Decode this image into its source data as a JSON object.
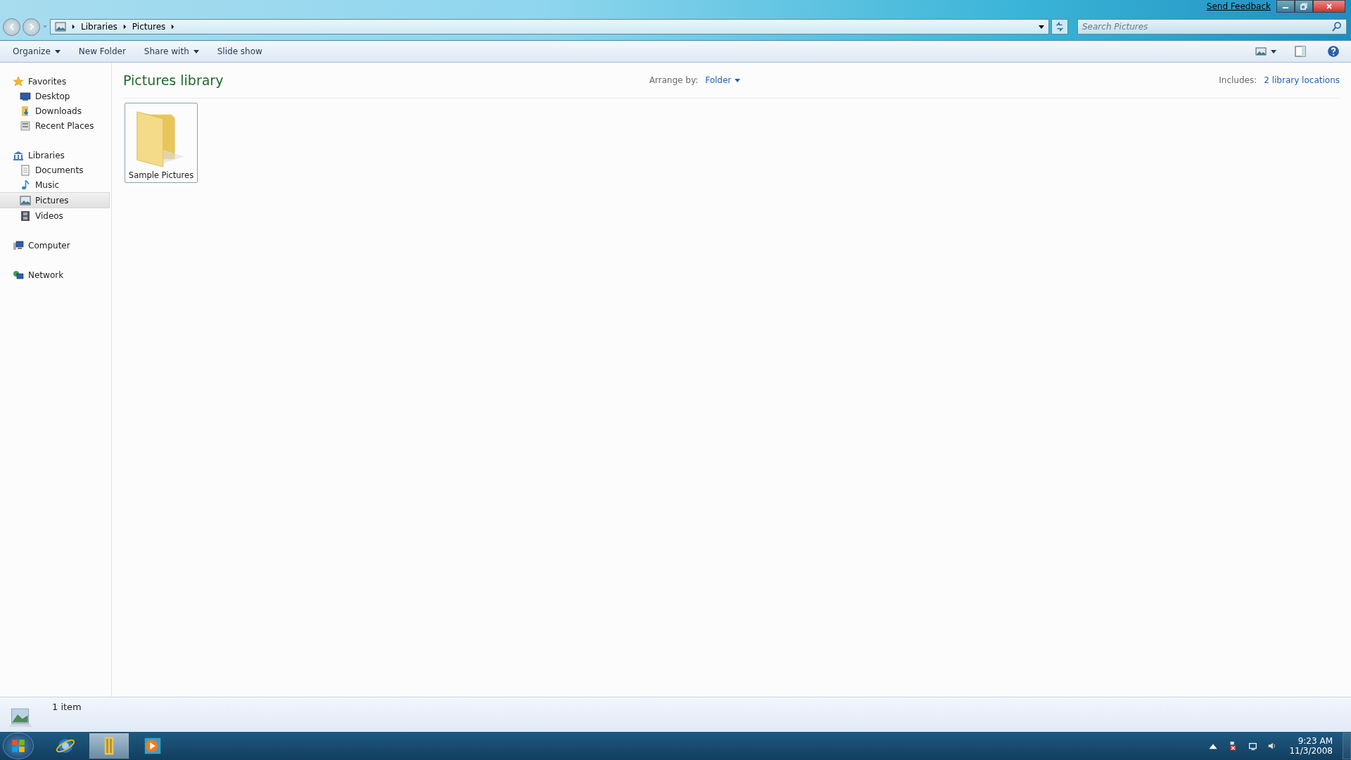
{
  "title_bar": {
    "feedback_link": "Send Feedback"
  },
  "address_bar": {
    "breadcrumbs": [
      "Libraries",
      "Pictures"
    ]
  },
  "search": {
    "placeholder": "Search Pictures"
  },
  "toolbar": {
    "buttons": [
      {
        "label": "Organize",
        "dropdown": true
      },
      {
        "label": "New Folder",
        "dropdown": false
      },
      {
        "label": "Share with",
        "dropdown": true
      },
      {
        "label": "Slide show",
        "dropdown": false
      }
    ]
  },
  "sidebar": {
    "items": [
      {
        "label": "Favorites",
        "selected": false,
        "children": [
          {
            "label": "Desktop",
            "selected": false
          },
          {
            "label": "Downloads",
            "selected": false
          },
          {
            "label": "Recent Places",
            "selected": false
          }
        ]
      },
      {
        "label": "Libraries",
        "selected": false,
        "children": [
          {
            "label": "Documents",
            "selected": false
          },
          {
            "label": "Music",
            "selected": false
          },
          {
            "label": "Pictures",
            "selected": true
          },
          {
            "label": "Videos",
            "selected": false
          }
        ]
      },
      {
        "label": "Computer",
        "selected": false
      },
      {
        "label": "Network",
        "selected": false
      }
    ]
  },
  "content": {
    "title": "Pictures library",
    "arrange_label": "Arrange by:",
    "arrange_value": "Folder",
    "includes_label": "Includes:",
    "includes_link": "2 library locations",
    "items": [
      {
        "label": "Sample Pictures",
        "selected": true
      }
    ]
  },
  "status_bar": {
    "text": "1 item"
  },
  "taskbar": {
    "time": "9:23 AM",
    "date": "11/3/2008",
    "apps": [
      {
        "active": false
      },
      {
        "active": true
      },
      {
        "active": false
      }
    ]
  }
}
